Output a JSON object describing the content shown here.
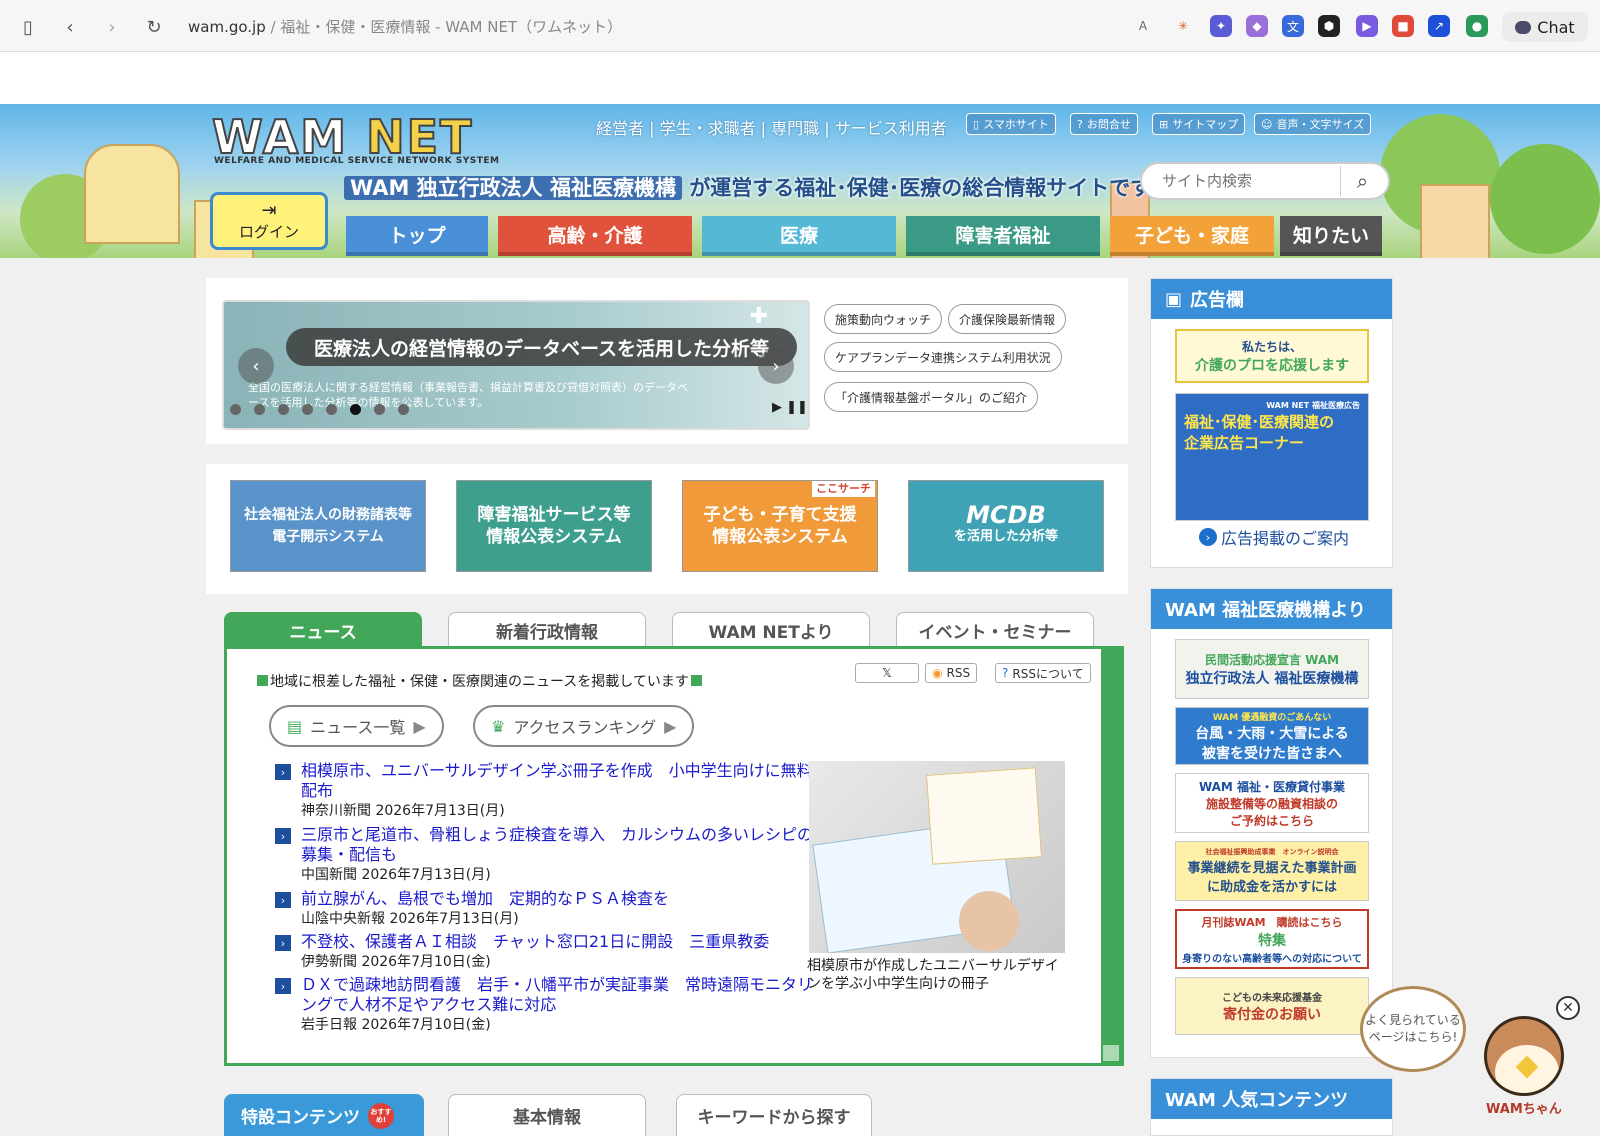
{
  "browser": {
    "url_host": "wam.go.jp",
    "url_rest": " / 福祉・保健・医療情報 - WAM NET（ワムネット）",
    "chat_label": "Chat"
  },
  "header": {
    "logo_wam": "WAM",
    "logo_net": "NET",
    "logo_sub": "WELFARE AND MEDICAL SERVICE NETWORK SYSTEM",
    "top_links": "経営者 | 学生・求職者 | 専門職 | サービス利用者",
    "buttons": [
      "スマホサイト",
      "お問合せ",
      "サイトマップ",
      "音声・文字サイズ"
    ],
    "tagline_org": "WAM 独立行政法人 福祉医療機構",
    "tagline_rest": "が運営する福祉･保健･医療の総合情報サイトです。",
    "search_placeholder": "サイト内検索",
    "login_label": "ログイン",
    "nav": [
      {
        "label": "トップ",
        "color": "#4a90d9"
      },
      {
        "label": "高齢・介護",
        "color": "#e0523c"
      },
      {
        "label": "医療",
        "color": "#55b8d4"
      },
      {
        "label": "障害者福祉",
        "color": "#3a9a85"
      },
      {
        "label": "子ども・家庭",
        "color": "#f3a23a"
      },
      {
        "label": "知りたい",
        "color": "#555555"
      }
    ]
  },
  "slider": {
    "title": "医療法人の経営情報のデータベースを活用した分析等",
    "desc": "全国の医療法人に関する経営情報（事業報告書、損益計算書及び貸借対照表）のデータベースを活用した分析等の情報を公表しています。",
    "active_dot": 6,
    "dot_count": 8
  },
  "quick_pills": [
    "施策動向ウォッチ",
    "介護保険最新情報",
    "ケアプランデータ連携システム利用状況",
    "「介護情報基盤ポータル」のご紹介"
  ],
  "banners": [
    {
      "line1": "社会福祉法人の財務諸表等",
      "line2": "電子開示システム",
      "color": "#5a93c9"
    },
    {
      "line1": "障害福祉サービス等",
      "line2": "情報公表システム",
      "color": "#3e9f8e"
    },
    {
      "line1": "子ども・子育て支援",
      "line2": "情報公表システム",
      "color": "#f09a3a",
      "badge": "ここサーチ"
    },
    {
      "line1": "MCDB",
      "line2": "を活用した分析等",
      "color": "#3fa3b5"
    }
  ],
  "news_tabs": [
    "ニュース",
    "新着行政情報",
    "WAM NETより",
    "イベント・セミナー"
  ],
  "news": {
    "intro": "地域に根差した福祉・保健・医療関連のニュースを掲載しています",
    "sns": [
      "𝕏",
      "RSS",
      "RSSについて"
    ],
    "btn_list": "ニュース一覧",
    "btn_rank": "アクセスランキング",
    "items": [
      {
        "title": "相模原市、ユニバーサルデザイン学ぶ冊子を作成　小中学生向けに無料配布",
        "source": "神奈川新聞 2026年7月13日(月)"
      },
      {
        "title": "三原市と尾道市、骨粗しょう症検査を導入　カルシウムの多いレシピの募集・配信も",
        "source": "中国新聞 2026年7月13日(月)"
      },
      {
        "title": "前立腺がん、島根でも増加　定期的なＰＳＡ検査を",
        "source": "山陰中央新報 2026年7月13日(月)"
      },
      {
        "title": "不登校、保護者ＡＩ相談　チャット窓口21日に開設　三重県教委",
        "source": "伊勢新聞 2026年7月10日(金)"
      },
      {
        "title": "ＤＸで過疎地訪問看護　岩手・八幡平市が実証事業　常時遠隔モニタリングで人材不足やアクセス難に対応",
        "source": "岩手日報 2026年7月10日(金)"
      }
    ],
    "image_caption": "相模原市が作成したユニバーサルデザインを学ぶ小中学生向けの冊子"
  },
  "bottom_tabs": [
    "特設コンテンツ",
    "基本情報",
    "キーワードから探す"
  ],
  "bottom_badge": "おすすめ!",
  "sidebar": {
    "ad_title": "広告欄",
    "ad1": {
      "line1": "私たちは、",
      "line2": "介護のプロを応援します"
    },
    "ad2": {
      "top": "WAM NET 福祉医療広告",
      "line1": "福祉･保健･医療関連の",
      "line2": "企業広告コーナー"
    },
    "ad_link": "広告掲載のご案内",
    "wam_title": "WAM 福祉医療機構より",
    "w1": {
      "line1": "民間活動応援宣言 WAM",
      "line2": "独立行政法人 福祉医療機構"
    },
    "w2": {
      "top": "WAM 優遇融資のごあんない",
      "line1": "台風・大雨・大雪による",
      "line2": "被害を受けた皆さまへ"
    },
    "w3": {
      "line1": "WAM 福祉・医療貸付事業",
      "line2": "施設整備等の融資相談の",
      "line3": "ご予約はこちら"
    },
    "w4": {
      "top": "社会福祉振興助成事業　オンライン説明会",
      "line1": "事業継続を見据えた事業計画",
      "line2": "に助成金を活かすには"
    },
    "w5": {
      "top": "月刊誌WAM　購読はこちら",
      "line1": "特集",
      "line2": "身寄りのない高齢者等への対応について"
    },
    "w6": {
      "line1": "こどもの未来応援基金",
      "line2": "寄付金のお願い"
    },
    "popular_title": "WAM 人気コンテンツ"
  },
  "mascot": {
    "speech": "よく見られている\nページはこちら!",
    "name": "WAMちゃん"
  }
}
